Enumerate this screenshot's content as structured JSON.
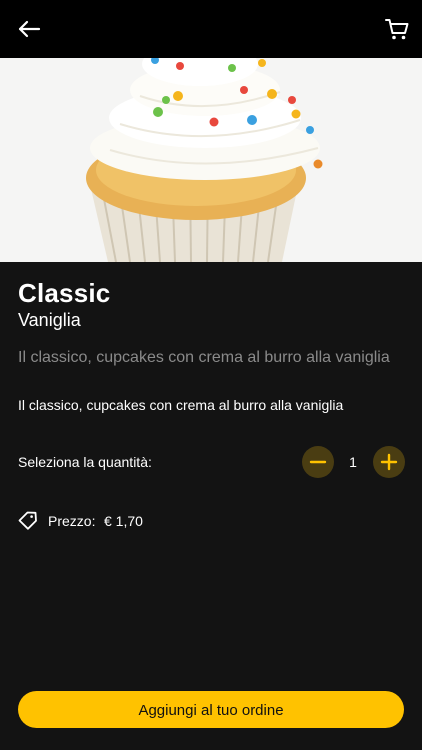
{
  "header": {
    "back_icon": "arrow-left-icon",
    "cart_icon": "shopping-cart-icon"
  },
  "product": {
    "name": "Classic",
    "flavor": "Vaniglia",
    "short_description": "Il classico, cupcakes con crema al burro alla vaniglia",
    "description": "Il classico, cupcakes con crema al burro alla vaniglia"
  },
  "quantity": {
    "label": "Seleziona la quantità:",
    "value": "1"
  },
  "price": {
    "label": "Prezzo:",
    "value": "€ 1,70",
    "icon": "price-tag-icon"
  },
  "cta": {
    "label": "Aggiungi al tuo ordine"
  },
  "colors": {
    "accent": "#ffc200",
    "background": "#131313",
    "muted_text": "#8a8a8a"
  }
}
